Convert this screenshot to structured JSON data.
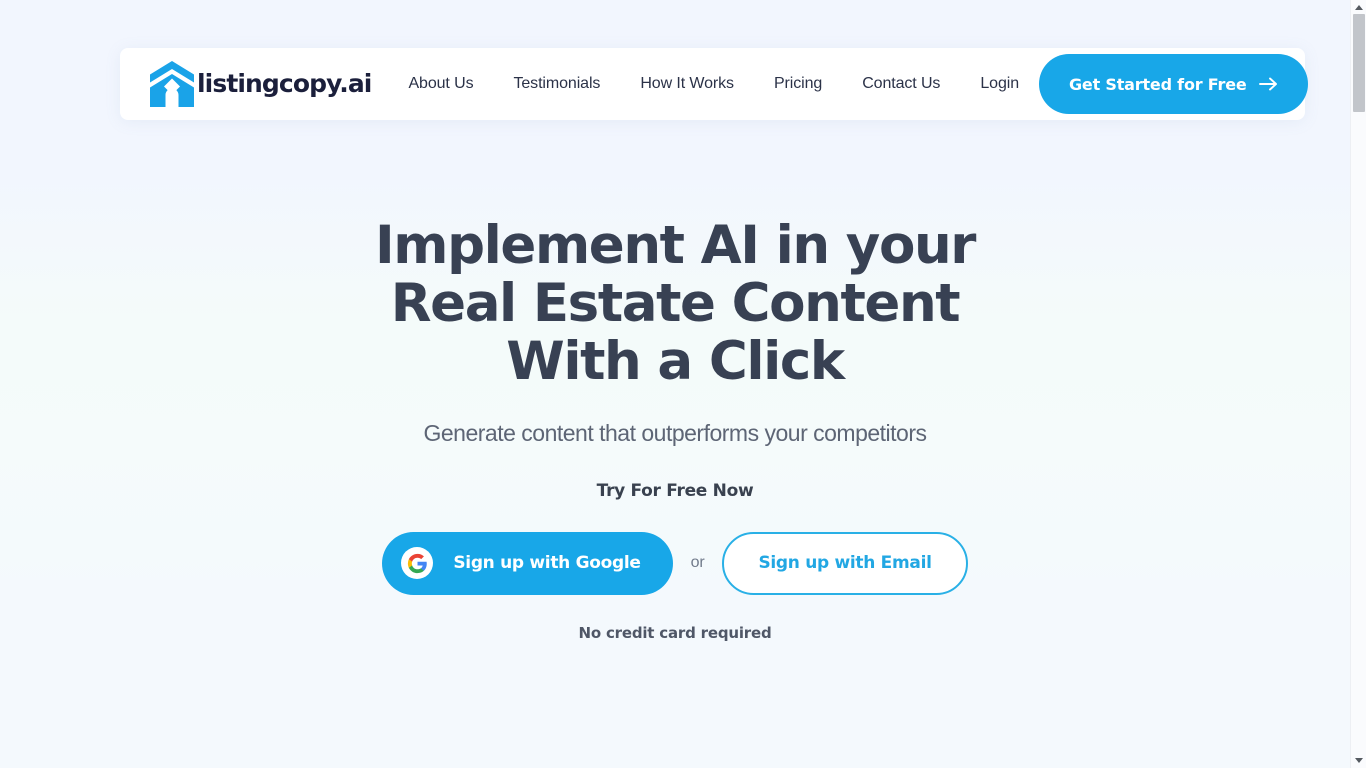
{
  "brand": {
    "name": "listingcopy.ai",
    "logo_icon": "house-logo-icon",
    "logo_color": "#1aa3e8"
  },
  "header": {
    "nav": [
      {
        "label": "About Us",
        "name": "nav-link-about-us"
      },
      {
        "label": "Testimonials",
        "name": "nav-link-testimonials"
      },
      {
        "label": "How It Works",
        "name": "nav-link-how-it-works"
      },
      {
        "label": "Pricing",
        "name": "nav-link-pricing"
      },
      {
        "label": "Contact Us",
        "name": "nav-link-contact-us"
      },
      {
        "label": "Login",
        "name": "nav-link-login"
      }
    ],
    "cta": {
      "label": "Get Started for Free",
      "icon": "arrow-right-icon",
      "background": "#18a7e8",
      "text_color": "#ffffff"
    }
  },
  "hero": {
    "title_lines": [
      "Implement AI in your",
      "Real Estate Content",
      "With a Click"
    ],
    "subtitle": "Generate content that outperforms your competitors",
    "try_label": "Try For Free Now",
    "google_button": {
      "label": "Sign up with Google",
      "icon": "google-g-icon",
      "background": "#18a7e8"
    },
    "separator": "or",
    "email_button": {
      "label": "Sign up with Email",
      "border_color": "#29b0e6",
      "text_color": "#22a7e3"
    },
    "footnote": "No credit card required"
  },
  "scrollbar": {
    "up_icon": "scroll-up-arrow-icon",
    "down_icon": "scroll-down-arrow-icon",
    "thumb": "scrollbar-thumb"
  },
  "theme": {
    "accent": "#18a7e8",
    "heading": "#384153",
    "body_text": "#5d6575",
    "page_background": "#f2f6fe"
  }
}
